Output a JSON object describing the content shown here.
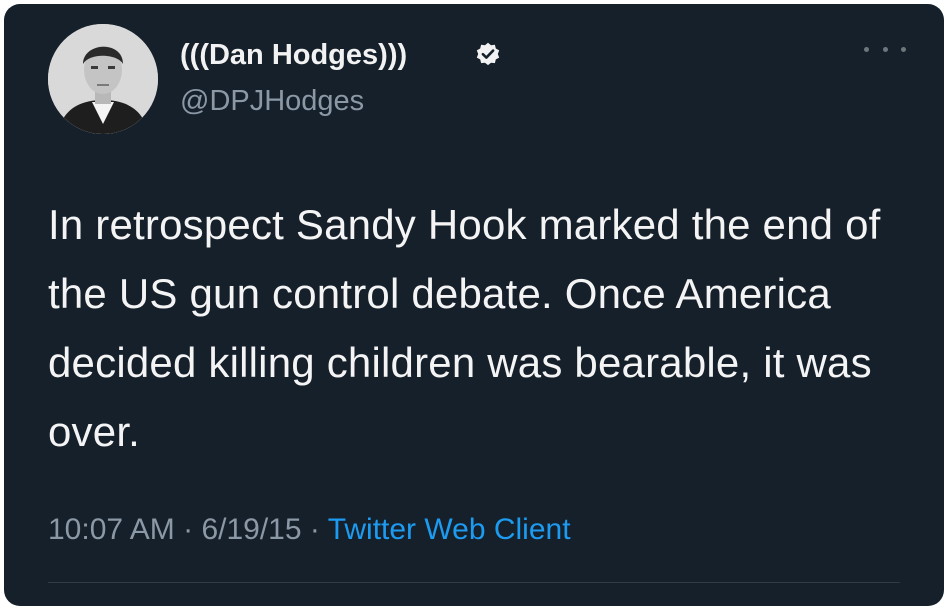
{
  "author": {
    "display_name": "(((Dan Hodges)))",
    "handle": "@DPJHodges",
    "verified": true
  },
  "tweet": {
    "text": "In retrospect Sandy Hook marked the end of the US gun control debate. Once America decided killing children was bearable, it was over.",
    "time": "10:07 AM",
    "date": "6/19/15",
    "separator": "·",
    "source": "Twitter Web Client"
  },
  "icons": {
    "verified": "verified-badge-icon",
    "more": "more-options-icon"
  },
  "colors": {
    "background": "#15202b",
    "link": "#1d9bf0",
    "secondary_text": "#8b98a5"
  }
}
